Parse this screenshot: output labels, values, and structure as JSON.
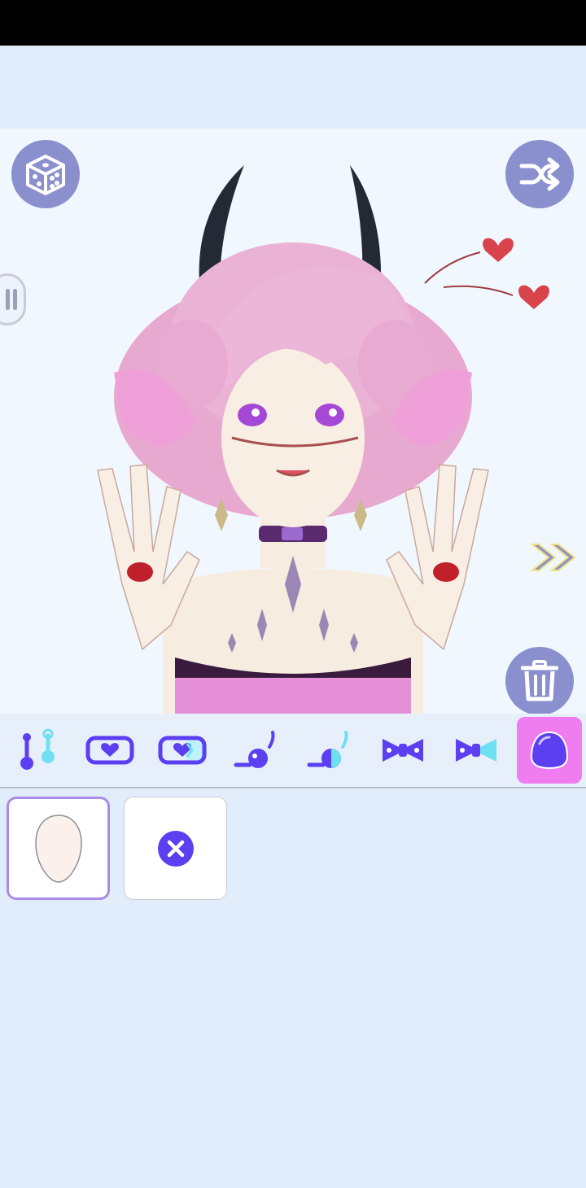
{
  "colors": {
    "accent_purple": "#5b3ff0",
    "accent_cyan": "#6fe0f2",
    "button_bg": "#8a8fce",
    "active_tab_bg": "#f07df0",
    "canvas_bg": "#f1f7fe",
    "panel_bg": "#e1edfb"
  },
  "icons": {
    "random": "dice-icon",
    "shuffle": "shuffle-icon",
    "delete": "trash-icon",
    "next": "double-chevron-right-icon",
    "side_panel": "side-panel-tab-icon"
  },
  "toolbar": {
    "items": [
      {
        "name": "piercing",
        "icon": "piercing-icon",
        "active": false
      },
      {
        "name": "choker",
        "icon": "heart-choker-icon",
        "active": false
      },
      {
        "name": "choker-alt",
        "icon": "heart-choker-alt-icon",
        "active": false
      },
      {
        "name": "earring",
        "icon": "earring-icon",
        "active": false
      },
      {
        "name": "earring-alt",
        "icon": "earring-alt-icon",
        "active": false
      },
      {
        "name": "bow",
        "icon": "bow-icon",
        "active": false
      },
      {
        "name": "bow-alt",
        "icon": "bow-alt-icon",
        "active": false
      },
      {
        "name": "body",
        "icon": "body-blob-icon",
        "active": true
      }
    ]
  },
  "options": {
    "items": [
      {
        "name": "skin-tone-pale",
        "icon": "face-shape-icon",
        "selected": true
      },
      {
        "name": "none",
        "icon": "remove-x-icon",
        "selected": false
      }
    ]
  }
}
